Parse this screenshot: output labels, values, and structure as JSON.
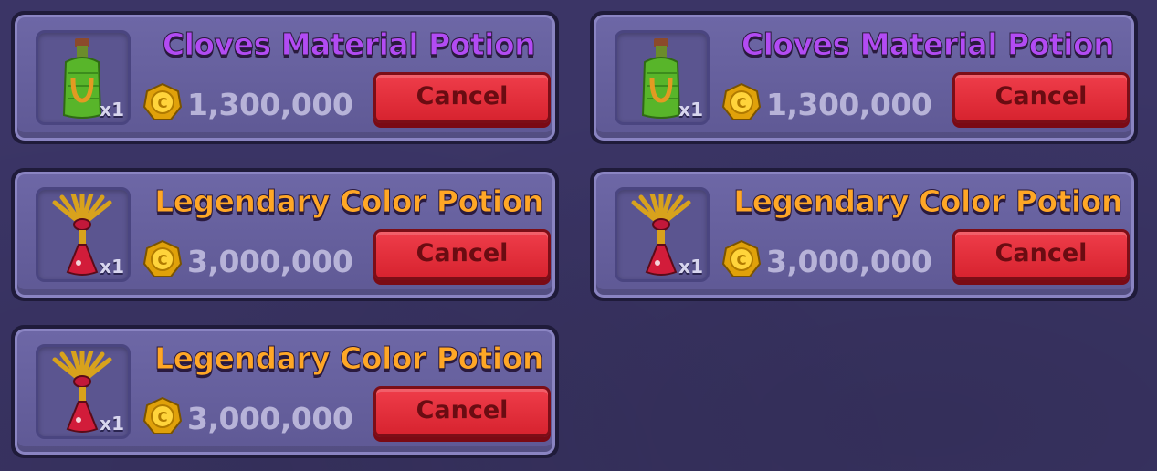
{
  "listings": [
    {
      "title": "Cloves Material Potion",
      "title_color": "purple",
      "item_icon": "green-bottle-potion-icon",
      "quantity": "x1",
      "price": "1,300,000",
      "button_label": "Cancel"
    },
    {
      "title": "Cloves Material Potion",
      "title_color": "purple",
      "item_icon": "green-bottle-potion-icon",
      "quantity": "x1",
      "price": "1,300,000",
      "button_label": "Cancel"
    },
    {
      "title": "Legendary Color Potion",
      "title_color": "orange",
      "item_icon": "red-flask-potion-icon",
      "quantity": "x1",
      "price": "3,000,000",
      "button_label": "Cancel"
    },
    {
      "title": "Legendary Color Potion",
      "title_color": "orange",
      "item_icon": "red-flask-potion-icon",
      "quantity": "x1",
      "price": "3,000,000",
      "button_label": "Cancel"
    },
    {
      "title": "Legendary Color Potion",
      "title_color": "orange",
      "item_icon": "red-flask-potion-icon",
      "quantity": "x1",
      "price": "3,000,000",
      "button_label": "Cancel"
    }
  ],
  "colors": {
    "purple_title": "#b24bf3",
    "orange_title": "#ffa726",
    "cancel_button": "#e3303c",
    "price_text": "#b7b3d8",
    "panel": "#6a64a3",
    "background": "#3b3566"
  }
}
